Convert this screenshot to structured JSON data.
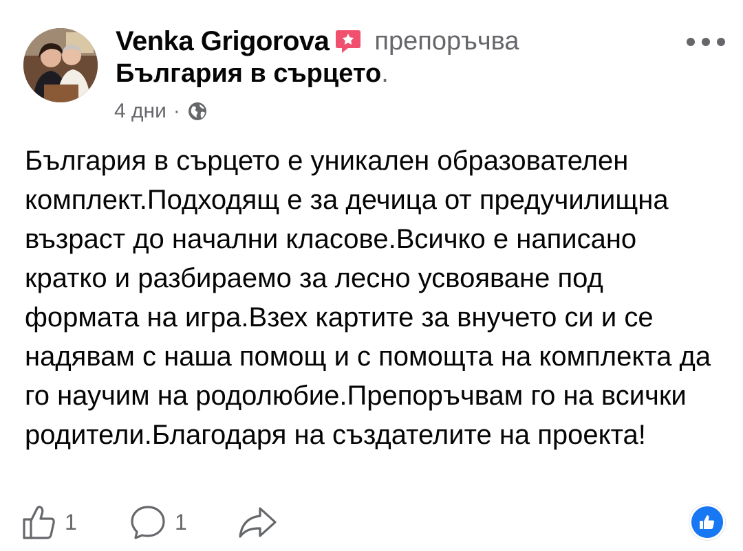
{
  "post": {
    "author": "Venka Grigorova",
    "action": "препоръчва",
    "page_name": "България в сърцето",
    "page_suffix": ".",
    "time": "4 дни",
    "meta_separator": "·",
    "audience_icon": "globe-icon",
    "body": "България в сърцето е уникален образователен комплект.Подходящ е за дечица от предучилищна възраст до начални класове.Всичко е написано кратко и разбираемо за лесно усвояване под формата на игра.Взех картите за внучето си и се надявам с наша помощ и с помощта на комплекта да го научим на родолюбие.Препоръчвам го на всички родители.Благодаря на създателите на проекта!"
  },
  "actions": {
    "like_count": "1",
    "comment_count": "1",
    "like_icon": "thumbs-up-icon",
    "comment_icon": "comment-icon",
    "share_icon": "share-icon",
    "reaction_icon": "like-reaction-icon"
  },
  "colors": {
    "text_primary": "#050505",
    "text_secondary": "#65676b",
    "recommend_badge": "#f0506e",
    "reaction_blue": "#1877f2"
  }
}
